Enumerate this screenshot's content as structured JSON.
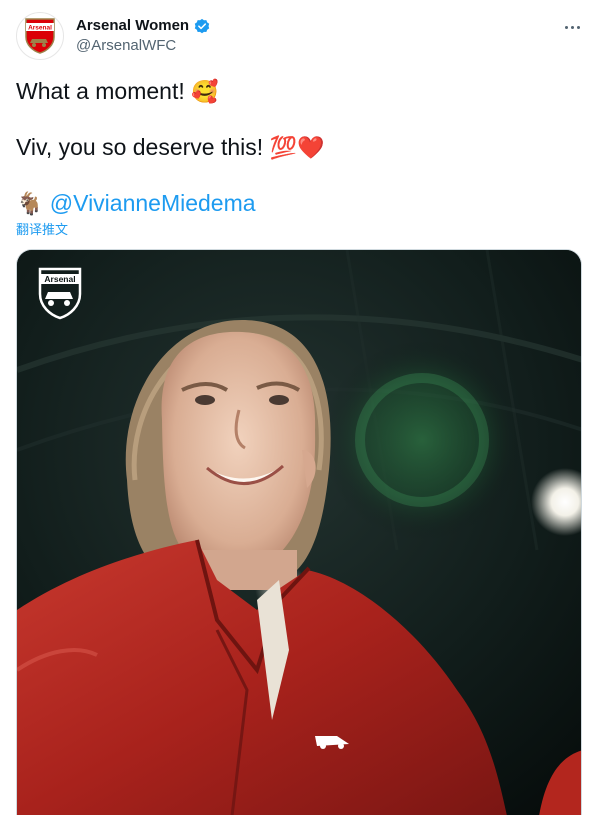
{
  "account": {
    "display_name": "Arsenal Women",
    "handle": "@ArsenalWFC",
    "verified": true,
    "avatar_text": "Arsenal"
  },
  "tweet": {
    "line1_text": "What a moment!",
    "line1_emoji": "🥰",
    "line2_text": "Viv, you so deserve this!",
    "line2_emoji_100": "💯",
    "line2_emoji_heart": "❤️",
    "line3_emoji": "🐐",
    "mention": "@VivianneMiedema",
    "translate_label": "翻译推文"
  },
  "media": {
    "logo_text": "Arsenal",
    "colors": {
      "jacket": "#b3261e",
      "background": "#0c1514",
      "glow_green": "#2f7a45"
    }
  },
  "colors": {
    "link": "#1d9bf0",
    "verified": "#1d9bf0",
    "secondary_text": "#536471"
  }
}
